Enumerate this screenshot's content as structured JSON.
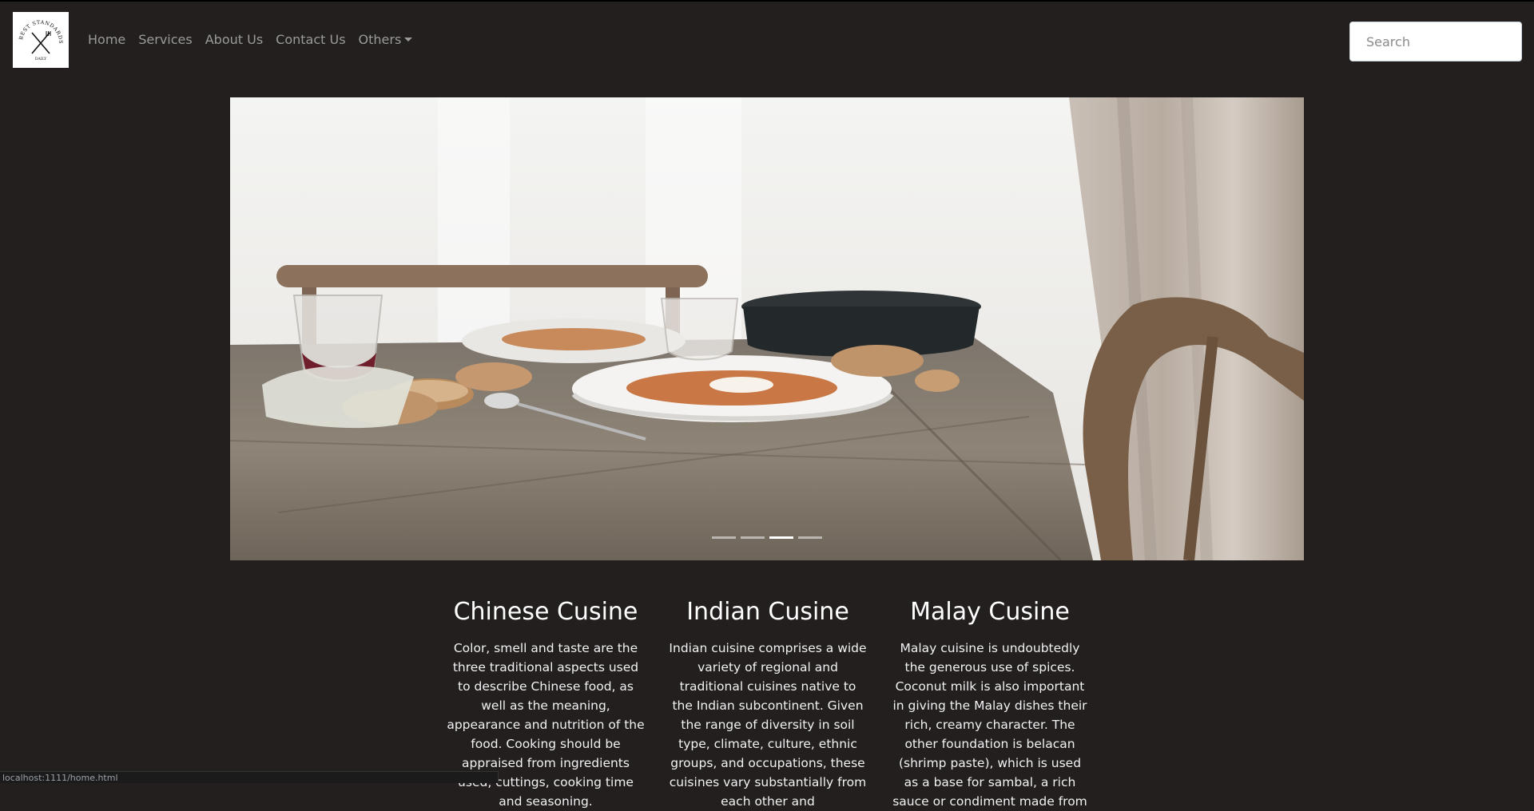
{
  "nav": {
    "logo_text": "BEST STANDARDS",
    "logo_sub": "DAILY",
    "links": [
      {
        "label": "Home"
      },
      {
        "label": "Services"
      },
      {
        "label": "About Us"
      },
      {
        "label": "Contact Us"
      },
      {
        "label": "Others"
      }
    ],
    "search_placeholder": "Search"
  },
  "carousel": {
    "image_icon": "dining-table-photo",
    "slide_count": 4,
    "active_index": 2
  },
  "cuisines": [
    {
      "title": "Chinese Cusine",
      "text": "Color, smell and taste are the three traditional aspects used to describe Chinese food, as well as the meaning, appearance and nutrition of the food. Cooking should be appraised from ingredients used, cuttings, cooking time and seasoning."
    },
    {
      "title": "Indian Cusine",
      "text": "Indian cuisine comprises a wide variety of regional and traditional cuisines native to the Indian subcontinent. Given the range of diversity in soil type, climate, culture, ethnic groups, and occupations, these cuisines vary substantially from each other and"
    },
    {
      "title": "Malay Cusine",
      "text": "Malay cuisine is undoubtedly the generous use of spices. Coconut milk is also important in giving the Malay dishes their rich, creamy character. The other foundation is belacan (shrimp paste), which is used as a base for sambal, a rich sauce or condiment made from"
    }
  ],
  "statusbar": {
    "url": "localhost:1111/home.html"
  },
  "colors": {
    "background": "#221f1e",
    "nav_link": "#9a9a9a",
    "heading": "#ffffff"
  }
}
